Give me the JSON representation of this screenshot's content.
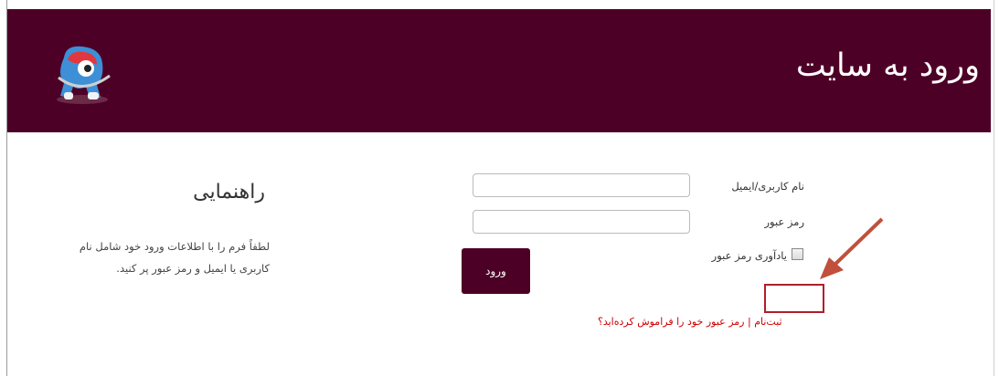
{
  "header": {
    "title": "ورود به سایت",
    "logo_icon": "site-logo-icon",
    "background": "#4d0026"
  },
  "guide": {
    "title": "راهنمایی",
    "text": "لطفاً فرم را با اطلاعات ورود خود شامل نام کاربری یا ایمیل و رمز عبور پر کنید."
  },
  "form": {
    "username_label": "نام کاربری/ایمیل",
    "username_value": "",
    "password_label": "رمز عبور",
    "password_value": "",
    "remember_label": "یادآوری رمز عبور",
    "remember_checked": false,
    "submit_label": "ورود"
  },
  "links": {
    "register": "ثبت‌نام",
    "separator": "|",
    "forgot": "رمز عبور خود را فراموش کرده‌اید؟"
  },
  "annotation": {
    "color": "#b01e2a",
    "arrow_icon": "arrow-icon"
  }
}
